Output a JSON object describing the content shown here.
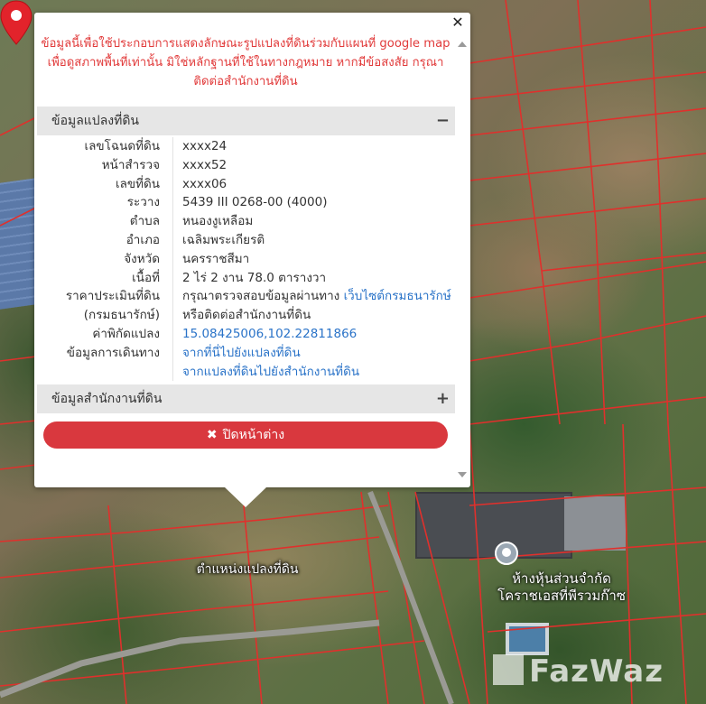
{
  "popup": {
    "close_symbol": "✕",
    "disclaimer_line1": "ข้อมูลนี้เพื่อใช้ประกอบการแสดงลักษณะรูปแปลงที่ดินร่วมกับแผนที่ google map",
    "disclaimer_line2": "เพื่อดูสภาพพื้นที่เท่านั้น มิใช่หลักฐานที่ใช้ในทางกฎหมาย หากมีข้อสงสัย กรุณา",
    "disclaimer_line3": "ติดต่อสำนักงานที่ดิน",
    "section1": {
      "title": "ข้อมูลแปลงที่ดิน",
      "toggle": "−"
    },
    "section2": {
      "title": "ข้อมูลสำนักงานที่ดิน",
      "toggle": "+"
    },
    "rows": {
      "deed_no": {
        "label": "เลขโฉนดที่ดิน",
        "value": "xxxx24"
      },
      "survey_page": {
        "label": "หน้าสำรวจ",
        "value": "xxxx52"
      },
      "land_no": {
        "label": "เลขที่ดิน",
        "value": "xxxx06"
      },
      "map_sheet": {
        "label": "ระวาง",
        "value": "5439 III 0268-00 (4000)"
      },
      "subdistrict": {
        "label": "ตำบล",
        "value": "หนองงูเหลือม"
      },
      "district": {
        "label": "อำเภอ",
        "value": "เฉลิมพระเกียรติ"
      },
      "province": {
        "label": "จังหวัด",
        "value": "นครราชสีมา"
      },
      "area": {
        "label": "เนื้อที่",
        "value": "2 ไร่ 2 งาน 78.0 ตารางวา"
      },
      "appraisal": {
        "label": "ราคาประเมินที่ดิน",
        "value": "กรุณาตรวจสอบข้อมูลผ่านทาง",
        "link": "เว็บไซต์กรมธนารักษ์",
        "label2": "(กรมธนารักษ์)",
        "value2": "หรือติดต่อสำนักงานที่ดิน"
      },
      "coords": {
        "label": "ค่าพิกัดแปลง",
        "value": "15.08425006,102.22811866"
      },
      "directions": {
        "label": "ข้อมูลการเดินทาง",
        "link1": "จากที่นี่ไปยังแปลงที่ดิน",
        "link2": "จากแปลงที่ดินไปยังสำนักงานที่ดิน"
      }
    },
    "close_button": {
      "icon": "✖",
      "label": "ปิดหน้าต่าง"
    }
  },
  "map": {
    "marker_label": "ตำแหน่งแปลงที่ดิน",
    "place_label_line1": "ห้างหุ้นส่วนจำกัด",
    "place_label_line2": "โคราชเอสที่พีรวมก๊าซ",
    "watermark": "FazWaz"
  },
  "colors": {
    "accent": "#d9383e",
    "disclaimer": "#e13a3a",
    "link": "#2a73c8",
    "parcel_lines": "#e0302c"
  }
}
